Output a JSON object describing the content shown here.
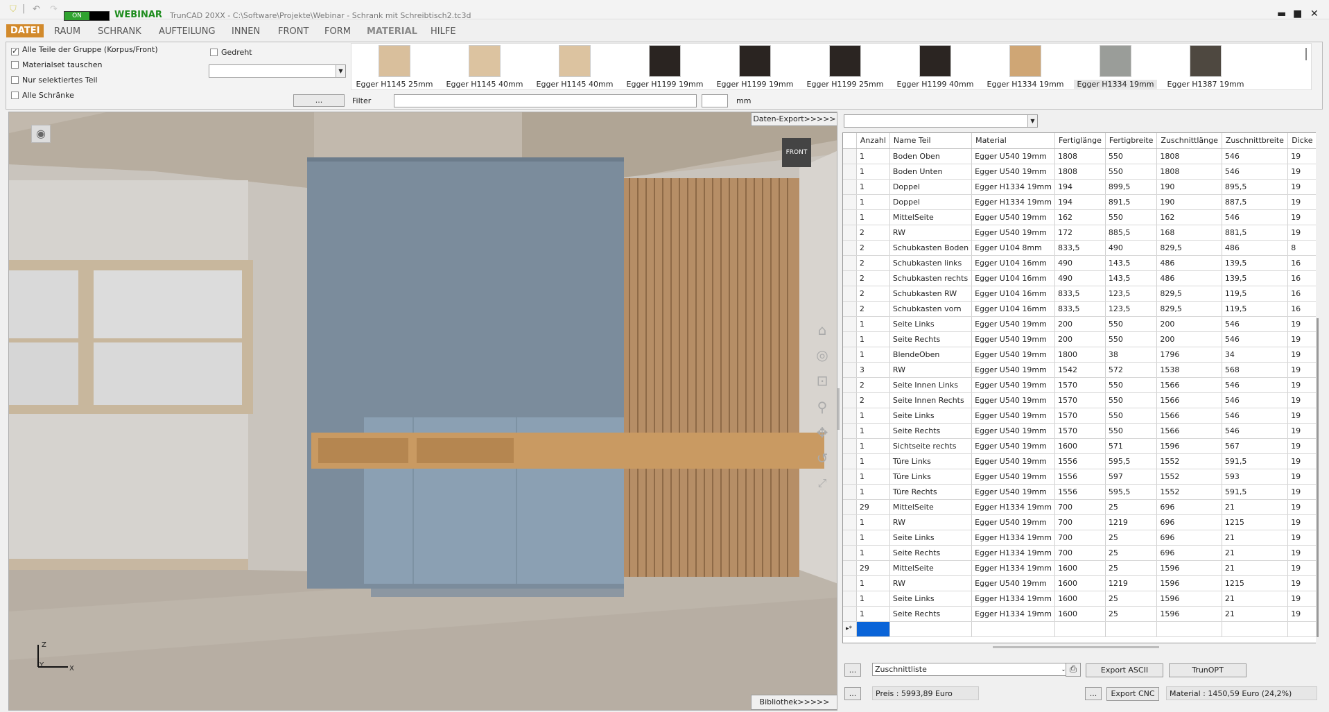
{
  "titlebar": {
    "toggle_label": "ON",
    "brand": "WEBINAR",
    "window_title": "TrunCAD 20XX - C:\\Software\\Projekte\\Webinar - Schrank mit Schreibtisch2.tc3d",
    "minimize": "▬",
    "maximize": "■",
    "close": "✕"
  },
  "menu": [
    "DATEI",
    "RAUM",
    "SCHRANK",
    "AUFTEILUNG",
    "INNEN",
    "FRONT",
    "FORM",
    "MATERIAL",
    "HILFE"
  ],
  "options": {
    "checkboxes": [
      {
        "label": "Alle Teile der Gruppe (Korpus/Front)",
        "checked": true
      },
      {
        "label": "Materialset tauschen",
        "checked": false
      },
      {
        "label": "Nur selektiertes Teil",
        "checked": false
      },
      {
        "label": "Alle Schränke",
        "checked": false
      }
    ],
    "gedreht_label": "Gedreht",
    "dots_button": "...",
    "filter_label": "Filter",
    "unit": "mm"
  },
  "materials": [
    {
      "label": "Egger H1145 25mm",
      "color": "#d9bf9c"
    },
    {
      "label": "Egger H1145 40mm",
      "color": "#dcc3a0"
    },
    {
      "label": "Egger H1145 40mm",
      "color": "#dcc3a0"
    },
    {
      "label": "Egger H1199 19mm",
      "color": "#2a2421"
    },
    {
      "label": "Egger H1199 19mm",
      "color": "#2a2421"
    },
    {
      "label": "Egger H1199 25mm",
      "color": "#2b2522"
    },
    {
      "label": "Egger H1199 40mm",
      "color": "#2b2522"
    },
    {
      "label": "Egger H1334 19mm",
      "color": "#cfa675"
    },
    {
      "label": "Egger H1334 19mm",
      "color": "#9a9d99"
    },
    {
      "label": "Egger H1387 19mm",
      "color": "#4e4840"
    }
  ],
  "viewport": {
    "daten_export": "Daten-Export>>>>>",
    "bibliothek": "Bibliothek>>>>>",
    "cube_label": "FRONT",
    "axis_z": "Z",
    "axis_y": "Y",
    "axis_x": "X"
  },
  "table": {
    "columns": [
      "Anzahl",
      "Name Teil",
      "Material",
      "Fertiglänge",
      "Fertigbreite",
      "Zuschnittlänge",
      "Zuschnittbreite",
      "Dicke"
    ],
    "rows": [
      [
        "1",
        "Boden Oben",
        "Egger U540 19mm",
        "1808",
        "550",
        "1808",
        "546",
        "19"
      ],
      [
        "1",
        "Boden Unten",
        "Egger U540 19mm",
        "1808",
        "550",
        "1808",
        "546",
        "19"
      ],
      [
        "1",
        "Doppel",
        "Egger H1334 19mm",
        "194",
        "899,5",
        "190",
        "895,5",
        "19"
      ],
      [
        "1",
        "Doppel",
        "Egger H1334 19mm",
        "194",
        "891,5",
        "190",
        "887,5",
        "19"
      ],
      [
        "1",
        "MittelSeite",
        "Egger U540 19mm",
        "162",
        "550",
        "162",
        "546",
        "19"
      ],
      [
        "2",
        "RW",
        "Egger U540 19mm",
        "172",
        "885,5",
        "168",
        "881,5",
        "19"
      ],
      [
        "2",
        "Schubkasten Boden",
        "Egger U104 8mm",
        "833,5",
        "490",
        "829,5",
        "486",
        "8"
      ],
      [
        "2",
        "Schubkasten links",
        "Egger U104 16mm",
        "490",
        "143,5",
        "486",
        "139,5",
        "16"
      ],
      [
        "2",
        "Schubkasten rechts",
        "Egger U104 16mm",
        "490",
        "143,5",
        "486",
        "139,5",
        "16"
      ],
      [
        "2",
        "Schubkasten RW",
        "Egger U104 16mm",
        "833,5",
        "123,5",
        "829,5",
        "119,5",
        "16"
      ],
      [
        "2",
        "Schubkasten vorn",
        "Egger U104 16mm",
        "833,5",
        "123,5",
        "829,5",
        "119,5",
        "16"
      ],
      [
        "1",
        "Seite Links",
        "Egger U540 19mm",
        "200",
        "550",
        "200",
        "546",
        "19"
      ],
      [
        "1",
        "Seite Rechts",
        "Egger U540 19mm",
        "200",
        "550",
        "200",
        "546",
        "19"
      ],
      [
        "1",
        "BlendeOben",
        "Egger U540 19mm",
        "1800",
        "38",
        "1796",
        "34",
        "19"
      ],
      [
        "3",
        "RW",
        "Egger U540 19mm",
        "1542",
        "572",
        "1538",
        "568",
        "19"
      ],
      [
        "2",
        "Seite Innen Links",
        "Egger U540 19mm",
        "1570",
        "550",
        "1566",
        "546",
        "19"
      ],
      [
        "2",
        "Seite Innen Rechts",
        "Egger U540 19mm",
        "1570",
        "550",
        "1566",
        "546",
        "19"
      ],
      [
        "1",
        "Seite Links",
        "Egger U540 19mm",
        "1570",
        "550",
        "1566",
        "546",
        "19"
      ],
      [
        "1",
        "Seite Rechts",
        "Egger U540 19mm",
        "1570",
        "550",
        "1566",
        "546",
        "19"
      ],
      [
        "1",
        "Sichtseite rechts",
        "Egger U540 19mm",
        "1600",
        "571",
        "1596",
        "567",
        "19"
      ],
      [
        "1",
        "Türe Links",
        "Egger U540 19mm",
        "1556",
        "595,5",
        "1552",
        "591,5",
        "19"
      ],
      [
        "1",
        "Türe Links",
        "Egger U540 19mm",
        "1556",
        "597",
        "1552",
        "593",
        "19"
      ],
      [
        "1",
        "Türe Rechts",
        "Egger U540 19mm",
        "1556",
        "595,5",
        "1552",
        "591,5",
        "19"
      ],
      [
        "29",
        "MittelSeite",
        "Egger H1334 19mm",
        "700",
        "25",
        "696",
        "21",
        "19"
      ],
      [
        "1",
        "RW",
        "Egger U540 19mm",
        "700",
        "1219",
        "696",
        "1215",
        "19"
      ],
      [
        "1",
        "Seite Links",
        "Egger H1334 19mm",
        "700",
        "25",
        "696",
        "21",
        "19"
      ],
      [
        "1",
        "Seite Rechts",
        "Egger H1334 19mm",
        "700",
        "25",
        "696",
        "21",
        "19"
      ],
      [
        "29",
        "MittelSeite",
        "Egger H1334 19mm",
        "1600",
        "25",
        "1596",
        "21",
        "19"
      ],
      [
        "1",
        "RW",
        "Egger U540 19mm",
        "1600",
        "1219",
        "1596",
        "1215",
        "19"
      ],
      [
        "1",
        "Seite Links",
        "Egger H1334 19mm",
        "1600",
        "25",
        "1596",
        "21",
        "19"
      ],
      [
        "1",
        "Seite Rechts",
        "Egger H1334 19mm",
        "1600",
        "25",
        "1596",
        "21",
        "19"
      ]
    ],
    "new_row_marker": "▸*"
  },
  "bottom": {
    "dots": "...",
    "list_select": "Zuschnittliste",
    "export_ascii": "Export ASCII",
    "trunopt": "TrunOPT",
    "price": "Preis : 5993,89 Euro",
    "export_cnc": "Export CNC",
    "material_cost": "Material : 1450,59 Euro (24,2%)"
  }
}
